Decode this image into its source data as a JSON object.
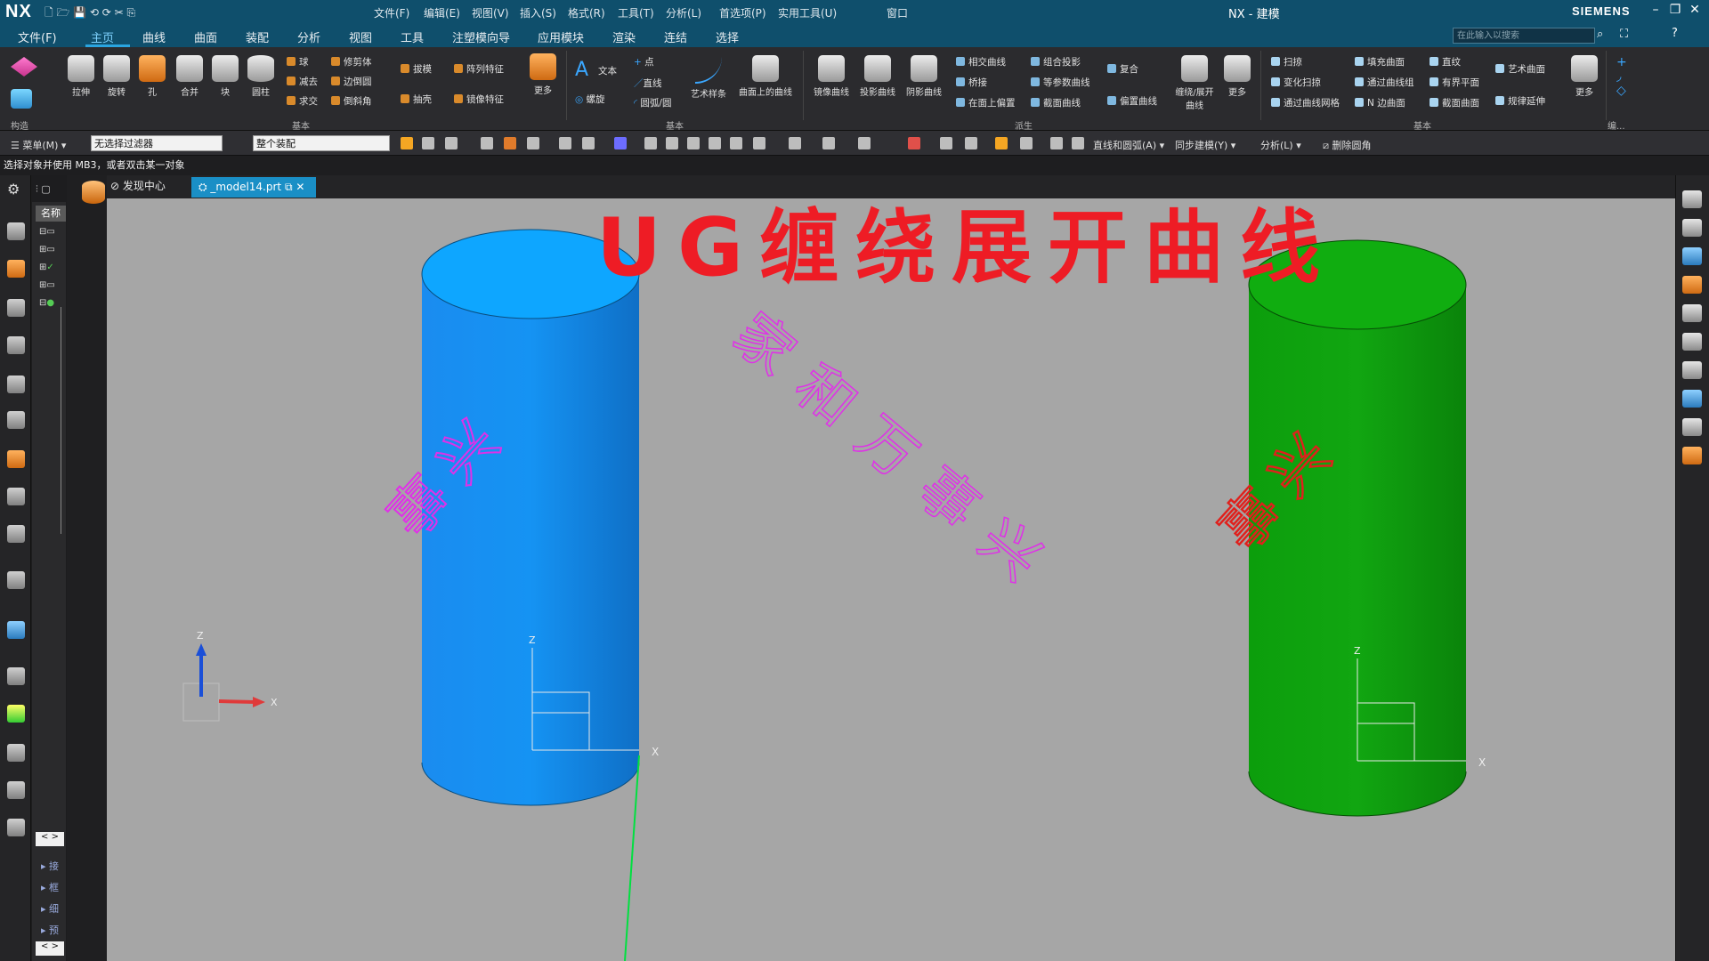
{
  "app": {
    "logo": "NX",
    "title": "NX - 建模",
    "brand": "SIEMENS"
  },
  "quick_access": {
    "menus": [
      "文件(F)",
      "编辑(E)",
      "视图(V)",
      "插入(S)",
      "格式(R)",
      "工具(T)",
      "分析(L)",
      "首选项(P)",
      "实用工具(U)",
      "窗口"
    ]
  },
  "menu_tabs": [
    "文件(F)",
    "主页",
    "曲线",
    "曲面",
    "装配",
    "分析",
    "视图",
    "工具",
    "注塑模向导",
    "应用模块",
    "渲染",
    "连结",
    "选择"
  ],
  "active_tab": "主页",
  "search_placeholder": "在此输入以搜索",
  "ribbon": {
    "big_buttons": [
      "拉伸",
      "旋转",
      "孔",
      "合并",
      "块",
      "圆柱"
    ],
    "feature_small": [
      "球",
      "修剪体",
      "减去",
      "边倒圆",
      "求交",
      "倒斜角"
    ],
    "feature_mid": [
      "拔模",
      "阵列特征",
      "抽壳",
      "镜像特征",
      "更多"
    ],
    "curve_small": [
      "文本",
      "点",
      "直线",
      "螺旋",
      "圆弧/圆"
    ],
    "curve_big": [
      "艺术样条",
      "曲面上的曲线"
    ],
    "derived_big": [
      "镜像曲线",
      "投影曲线",
      "阴影曲线"
    ],
    "derived_small": [
      "相交曲线",
      "组合投影",
      "桥接",
      "等参数曲线",
      "在面上偏置",
      "截面曲线",
      "复合",
      "偏置曲线"
    ],
    "derived_more": [
      "缠绕/展开曲线",
      "更多"
    ],
    "surface_small": [
      "扫掠",
      "填充曲面",
      "直纹",
      "艺术曲面",
      "变化扫掠",
      "通过曲线组",
      "有界平面",
      "通过曲线网格",
      "N 边曲面",
      "截面曲面",
      "规律延伸"
    ],
    "surface_more": "更多",
    "group_labels": [
      "构造",
      "基本",
      "基本",
      "派生",
      "基本",
      "编..."
    ]
  },
  "toolbar2": {
    "menu": "菜单(M)",
    "filter": "无选择过滤器",
    "scope": "整个装配",
    "items": [
      "直线和圆弧(A)",
      "同步建模(Y)",
      "分析(L)",
      "删除圆角"
    ]
  },
  "cue_line": "选择对象并使用 MB3，或者双击某一对象",
  "navigator": {
    "header": "名称",
    "expanders": [
      "接",
      "框",
      "细",
      "预"
    ]
  },
  "doc_tabs": {
    "discover": "发现中心",
    "model": "_model14.prt"
  },
  "viewport": {
    "overlay_title": "UG缠绕展开曲线",
    "flat_text": "家和万事兴",
    "wrapped_text_blue": "事兴",
    "wrapped_text_green": "事兴",
    "axis_labels": {
      "z": "Z",
      "x": "X"
    }
  },
  "colors": {
    "title_bar": "#0f4f6c",
    "viewport_bg": "#a6a6a6",
    "cyl_blue": "#1691f0",
    "cyl_green": "#109a10",
    "wrap_magenta": "#e030e8",
    "wrap_red": "#e0201c",
    "overlay_red": "#ee1c25"
  },
  "icons": [
    "search-icon",
    "minimize-icon",
    "maximize-icon",
    "close-icon",
    "help-icon",
    "settings-icon"
  ]
}
